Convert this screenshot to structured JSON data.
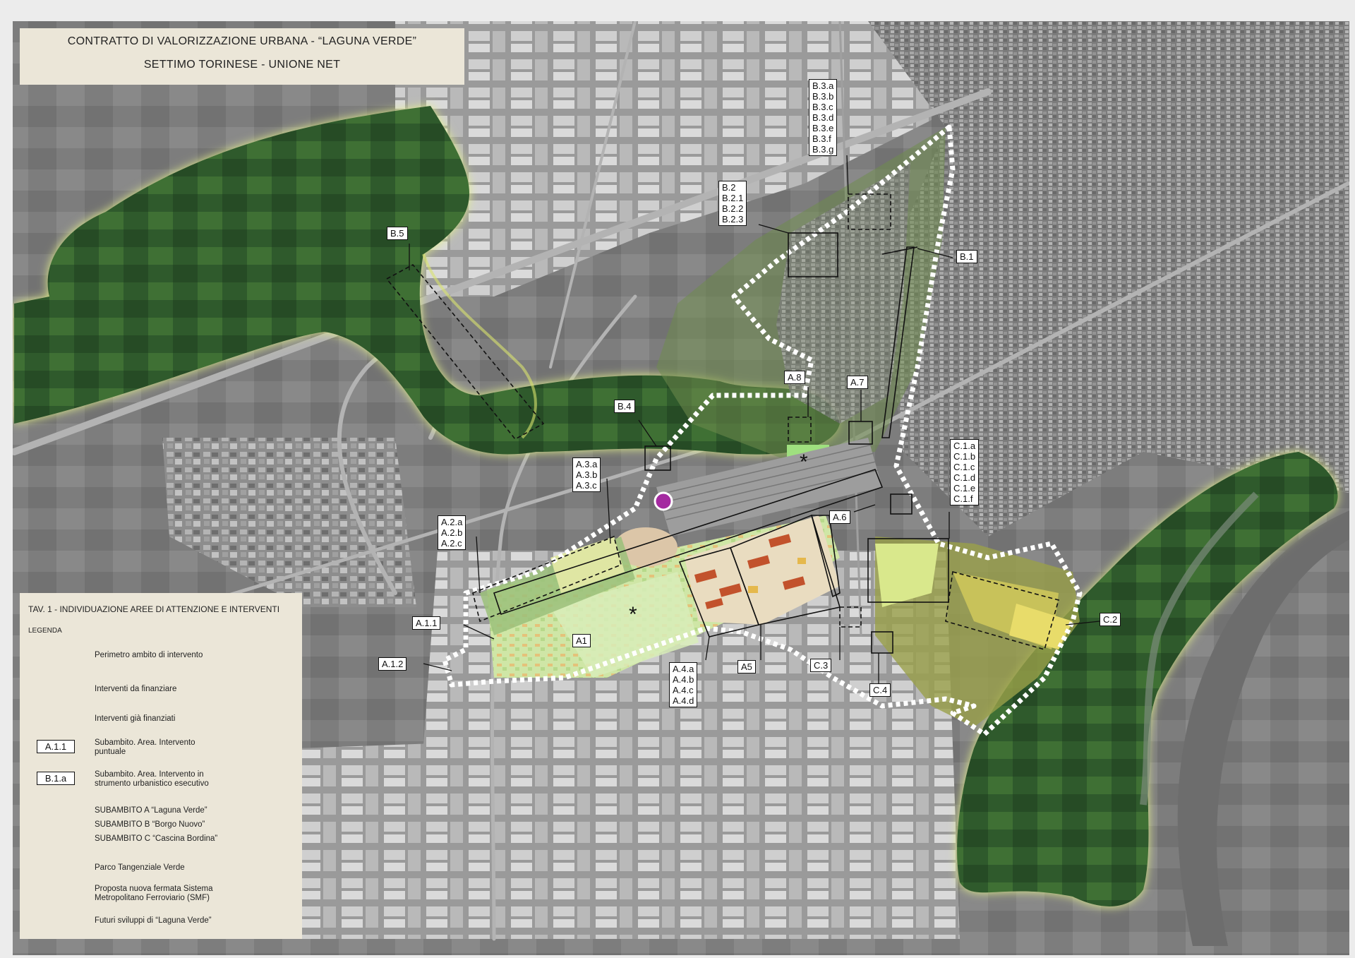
{
  "header": {
    "title": "CONTRATTO DI VALORIZZAZIONE URBANA - “LAGUNA VERDE”",
    "subtitle": "SETTIMO TORINESE - UNIONE NET"
  },
  "legend": {
    "title": "TAV. 1 - INDIVIDUAZIONE AREE DI ATTENZIONE E INTERVENTI",
    "heading": "LEGENDA",
    "perimeter": "Perimetro ambito di intervento",
    "to_finance": "Interventi da finanziare",
    "financed": "Interventi già finanziati",
    "sample_a11": "A.1.1",
    "point_intervention_1": "Subambito. Area. Intervento",
    "point_intervention_2": "puntuale",
    "sample_b1a": "B.1.a",
    "exec_intervention_1": "Subambito. Area. Intervento in",
    "exec_intervention_2": "strumento urbanistico esecutivo",
    "sub_a": "SUBAMBITO A “Laguna Verde”",
    "sub_b": "SUBAMBITO B “Borgo Nuovo”",
    "sub_c": "SUBAMBITO C “Cascina Bordina”",
    "park": "Parco Tangenziale Verde",
    "station_1": "Proposta nuova fermata Sistema",
    "station_2": "Metropolitano Ferroviario (SMF)",
    "future": "Futuri sviluppi di “Laguna Verde”"
  },
  "colors": {
    "park_green": "#2f5a2c",
    "park_glow": "#e2ef8a",
    "station": "#a42aa0",
    "legend_bg": "#ebe6d8"
  },
  "labels": {
    "b33": [
      "B.3.a",
      "B.3.b",
      "B.3.c",
      "B.3.d",
      "B.3.e",
      "B.3.f",
      "B.3.g"
    ],
    "b2": [
      "B.2",
      "B.2.1",
      "B.2.2",
      "B.2.3"
    ],
    "b5": [
      "B.5"
    ],
    "b1": [
      "B.1"
    ],
    "a8": [
      "A.8"
    ],
    "a7": [
      "A.7"
    ],
    "b4": [
      "B.4"
    ],
    "a3": [
      "A.3.a",
      "A.3.b",
      "A.3.c"
    ],
    "c1": [
      "C.1.a",
      "C.1.b",
      "C.1.c",
      "C.1.d",
      "C.1.e",
      "C.1.f"
    ],
    "a6": [
      "A.6"
    ],
    "a2": [
      "A.2.a",
      "A.2.b",
      "A.2.c"
    ],
    "a11": [
      "A.1.1"
    ],
    "a1": [
      "A1"
    ],
    "a12": [
      "A.1.2"
    ],
    "a4": [
      "A.4.a",
      "A.4.b",
      "A.4.c",
      "A.4.d"
    ],
    "a5": [
      "A5"
    ],
    "c3": [
      "C.3"
    ],
    "c4": [
      "C.4"
    ],
    "c2": [
      "C.2"
    ]
  }
}
